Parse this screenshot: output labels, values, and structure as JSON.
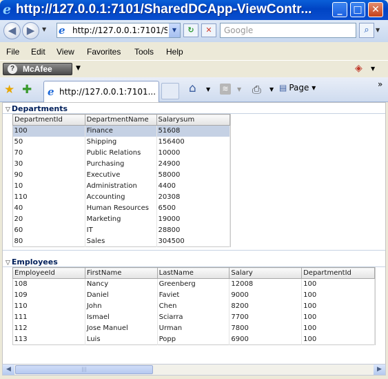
{
  "window": {
    "title": "http://127.0.0.1:7101/SharedDCApp-ViewContr...",
    "minimize": "_",
    "maximize": "□",
    "close": "✕"
  },
  "address_bar": {
    "url": "http://127.0.0.1:7101/S",
    "search_placeholder": "Google"
  },
  "menu": [
    "File",
    "Edit",
    "View",
    "Favorites",
    "Tools",
    "Help"
  ],
  "mcafee": {
    "label": "McAfee"
  },
  "tab": {
    "label": "http://127.0.0.1:7101..."
  },
  "command_bar": {
    "page_label": "Page"
  },
  "departments": {
    "title": "Departments",
    "columns": [
      "DepartmentId",
      "DepartmentName",
      "Salarysum"
    ],
    "rows": [
      [
        "100",
        "Finance",
        "51608"
      ],
      [
        "50",
        "Shipping",
        "156400"
      ],
      [
        "70",
        "Public Relations",
        "10000"
      ],
      [
        "30",
        "Purchasing",
        "24900"
      ],
      [
        "90",
        "Executive",
        "58000"
      ],
      [
        "10",
        "Administration",
        "4400"
      ],
      [
        "110",
        "Accounting",
        "20308"
      ],
      [
        "40",
        "Human Resources",
        "6500"
      ],
      [
        "20",
        "Marketing",
        "19000"
      ],
      [
        "60",
        "IT",
        "28800"
      ],
      [
        "80",
        "Sales",
        "304500"
      ]
    ],
    "selected_row": 0
  },
  "employees": {
    "title": "Employees",
    "columns": [
      "EmployeeId",
      "FirstName",
      "LastName",
      "Salary",
      "DepartmentId"
    ],
    "rows": [
      [
        "108",
        "Nancy",
        "Greenberg",
        "12008",
        "100"
      ],
      [
        "109",
        "Daniel",
        "Faviet",
        "9000",
        "100"
      ],
      [
        "110",
        "John",
        "Chen",
        "8200",
        "100"
      ],
      [
        "111",
        "Ismael",
        "Sciarra",
        "7700",
        "100"
      ],
      [
        "112",
        "Jose Manuel",
        "Urman",
        "7800",
        "100"
      ],
      [
        "113",
        "Luis",
        "Popp",
        "6900",
        "100"
      ]
    ]
  }
}
